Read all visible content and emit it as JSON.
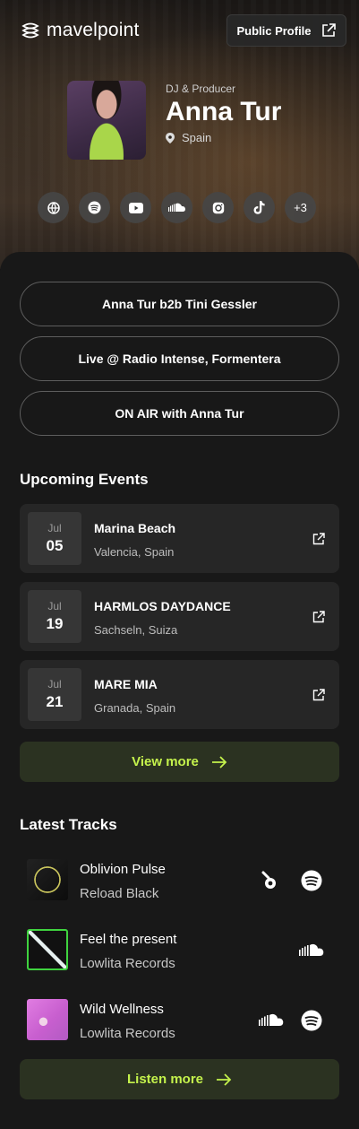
{
  "header": {
    "brand": "mavelpoint",
    "public_profile_label": "Public Profile"
  },
  "profile": {
    "role": "DJ & Producer",
    "name": "Anna Tur",
    "location": "Spain"
  },
  "socials": [
    {
      "icon": "globe-icon"
    },
    {
      "icon": "spotify-icon"
    },
    {
      "icon": "youtube-icon"
    },
    {
      "icon": "soundcloud-icon"
    },
    {
      "icon": "instagram-icon"
    },
    {
      "icon": "tiktok-icon"
    },
    {
      "label": "+3"
    }
  ],
  "links": [
    {
      "label": "Anna Tur b2b Tini Gessler"
    },
    {
      "label": "Live @ Radio Intense, Formentera"
    },
    {
      "label": "ON AIR with Anna Tur"
    }
  ],
  "events_section": {
    "title": "Upcoming Events",
    "items": [
      {
        "month": "Jul",
        "day": "05",
        "title": "Marina Beach",
        "location": "Valencia, Spain"
      },
      {
        "month": "Jul",
        "day": "19",
        "title": "HARMLOS DAYDANCE",
        "location": "Sachseln, Suiza"
      },
      {
        "month": "Jul",
        "day": "21",
        "title": "MARE MIA",
        "location": "Granada, Spain"
      }
    ],
    "view_more_label": "View more"
  },
  "tracks_section": {
    "title": "Latest Tracks",
    "items": [
      {
        "title": "Oblivion Pulse",
        "label": "Reload Black",
        "platforms": [
          "beatport-icon",
          "spotify-icon"
        ]
      },
      {
        "title": "Feel the present",
        "label": "Lowlita Records",
        "platforms": [
          "soundcloud-icon"
        ]
      },
      {
        "title": "Wild Wellness",
        "label": "Lowlita Records",
        "platforms": [
          "soundcloud-icon",
          "spotify-icon"
        ]
      }
    ],
    "listen_more_label": "Listen more"
  },
  "colors": {
    "accent": "#c4f24c",
    "accent_bg": "#2b3221",
    "panel_bg": "#181818",
    "card_bg": "#262626"
  }
}
